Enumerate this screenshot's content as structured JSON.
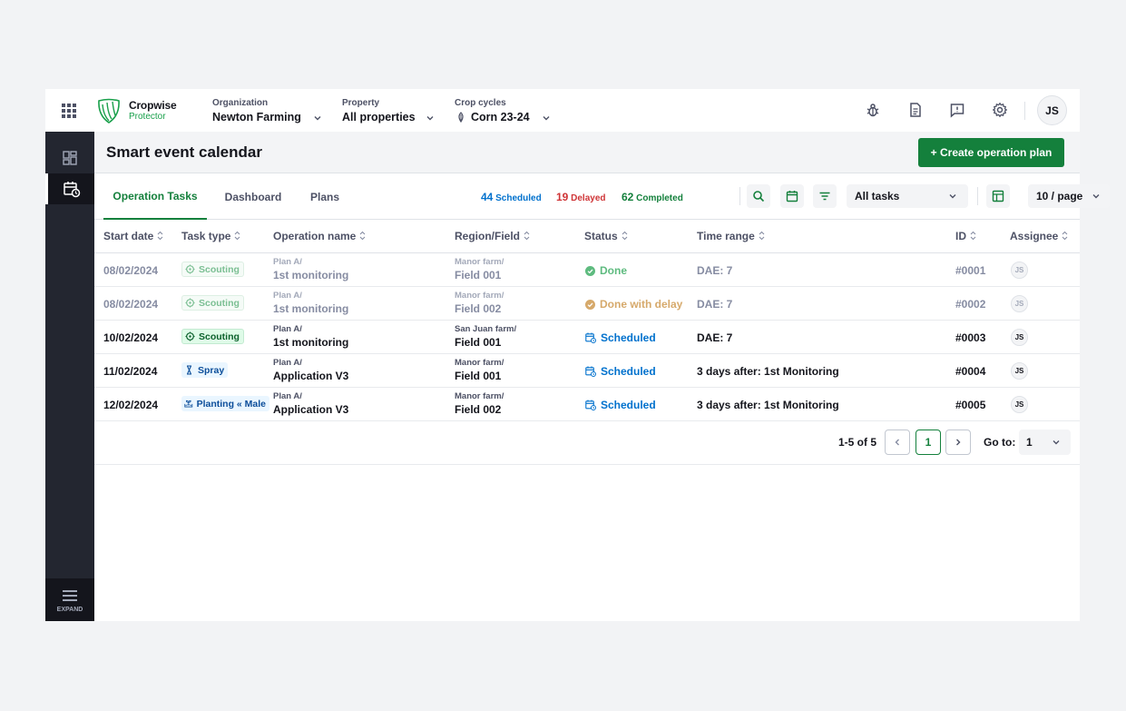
{
  "topbar": {
    "brand": "Cropwise",
    "product": "Protector",
    "organization": {
      "label": "Organization",
      "value": "Newton Farming"
    },
    "property": {
      "label": "Property",
      "value": "All properties"
    },
    "crop_cycles": {
      "label": "Crop cycles",
      "value": "Corn 23-24"
    },
    "user_initials": "JS"
  },
  "sidebar": {
    "expand_label": "EXPAND"
  },
  "page": {
    "title": "Smart event calendar",
    "create_button": "+ Create operation plan"
  },
  "tabs": [
    "Operation Tasks",
    "Dashboard",
    "Plans"
  ],
  "stats": {
    "scheduled": {
      "count": "44",
      "label": "Scheduled",
      "color": "#0071CD"
    },
    "delayed": {
      "count": "19",
      "label": "Delayed",
      "color": "#CF3537"
    },
    "completed": {
      "count": "62",
      "label": "Completed",
      "color": "#14803C"
    }
  },
  "filters": {
    "task_filter": "All tasks",
    "page_size": "10 / page"
  },
  "table": {
    "headers": [
      "Start date",
      "Task type",
      "Operation name",
      "Region/Field",
      "Status",
      "Time range",
      "ID",
      "Assignee"
    ],
    "rows": [
      {
        "date": "08/02/2024",
        "type": "Scouting",
        "op_plan": "Plan A/",
        "op_name": "1st monitoring",
        "region": "Manor farm/",
        "field": "Field 001",
        "status": "Done",
        "time": "DAE: 7",
        "id": "#0001",
        "assignee": "JS"
      },
      {
        "date": "08/02/2024",
        "type": "Scouting",
        "op_plan": "Plan A/",
        "op_name": "1st monitoring",
        "region": "Manor farm/",
        "field": "Field 002",
        "status": "Done with delay",
        "time": "DAE: 7",
        "id": "#0002",
        "assignee": "JS"
      },
      {
        "date": "10/02/2024",
        "type": "Scouting",
        "op_plan": "Plan A/",
        "op_name": "1st monitoring",
        "region": "San Juan farm/",
        "field": "Field 001",
        "status": "Scheduled",
        "time": "DAE: 7",
        "id": "#0003",
        "assignee": "JS"
      },
      {
        "date": "11/02/2024",
        "type": "Spray",
        "op_plan": "Plan A/",
        "op_name": "Application V3",
        "region": "Manor farm/",
        "field": "Field 001",
        "status": "Scheduled",
        "time": "3 days after: 1st Monitoring",
        "id": "#0004",
        "assignee": "JS"
      },
      {
        "date": "12/02/2024",
        "type": "Planting « Male",
        "op_plan": "Plan A/",
        "op_name": "Application V3",
        "region": "Manor farm/",
        "field": "Field 002",
        "status": "Scheduled",
        "time": "3 days after: 1st Monitoring",
        "id": "#0005",
        "assignee": "JS"
      }
    ]
  },
  "pagination": {
    "total": "1-5 of 5",
    "current_page": "1",
    "goto_label": "Go to:",
    "goto_value": "1"
  }
}
